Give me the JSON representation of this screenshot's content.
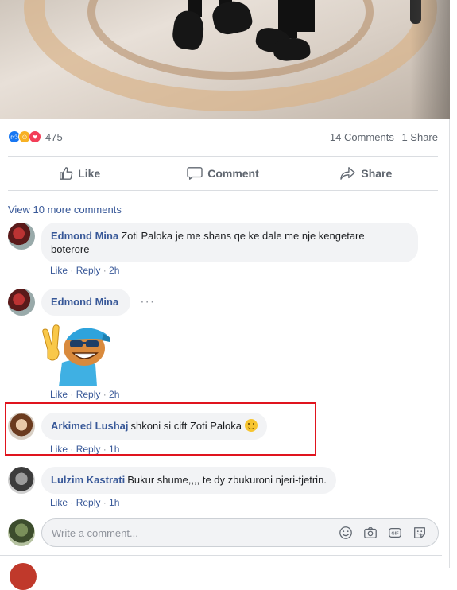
{
  "post": {
    "reactions": {
      "types": [
        "like-icon",
        "haha-icon",
        "love-icon"
      ],
      "count": "475"
    },
    "comments_count": "14 Comments",
    "shares_count": "1 Share",
    "actions": {
      "like": "Like",
      "comment": "Comment",
      "share": "Share"
    },
    "view_more": "View 10 more comments"
  },
  "comments": [
    {
      "author": "Edmond Mina",
      "text": "Zoti Paloka je me shans qe ke dale me nje kengetare",
      "text_line2": "boterore",
      "like": "Like",
      "reply": "Reply",
      "time": "2h"
    },
    {
      "author": "Edmond Mina",
      "dots": "···",
      "like": "Like",
      "reply": "Reply",
      "time": "2h"
    },
    {
      "author": "Arkimed Lushaj",
      "text": "shkoni si cift Zoti Paloka",
      "like": "Like",
      "reply": "Reply",
      "time": "1h"
    },
    {
      "author": "Lulzim Kastrati",
      "text": "Bukur shume,,,, te dy zbukuroni njeri-tjetrin.",
      "like": "Like",
      "reply": "Reply",
      "time": "1h"
    }
  ],
  "composer": {
    "placeholder": "Write a comment...",
    "tools": [
      "emoji-icon",
      "camera-icon",
      "gif-icon",
      "sticker-icon"
    ]
  },
  "colors": {
    "link": "#385898",
    "highlight_border": "#e0141e",
    "like_blue": "#1877f2"
  }
}
